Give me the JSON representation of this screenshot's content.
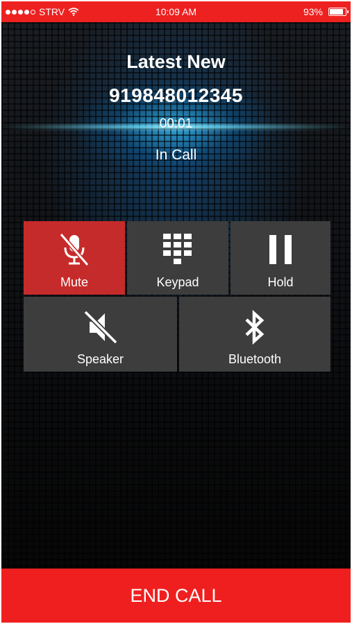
{
  "status_bar": {
    "carrier": "STRV",
    "time": "10:09 AM",
    "battery_percent": "93%",
    "battery_level": 0.93,
    "signal_bars": 4,
    "signal_max": 5
  },
  "call": {
    "contact_name": "Latest New",
    "phone_number": "919848012345",
    "duration": "00:01",
    "status": "In Call"
  },
  "controls": {
    "mute": {
      "label": "Mute",
      "active": true,
      "icon": "microphone-muted-icon"
    },
    "keypad": {
      "label": "Keypad",
      "active": false,
      "icon": "keypad-grid-icon"
    },
    "hold": {
      "label": "Hold",
      "active": false,
      "icon": "pause-icon"
    },
    "speaker": {
      "label": "Speaker",
      "active": false,
      "icon": "speaker-muted-icon"
    },
    "bluetooth": {
      "label": "Bluetooth",
      "active": false,
      "icon": "bluetooth-icon"
    }
  },
  "end_call": {
    "label": "END CALL"
  },
  "colors": {
    "accent_red": "#ee2121",
    "active_button": "#c62b2b",
    "button_bg": "#3d3d3d",
    "glow_blue": "#3cc8ff"
  }
}
